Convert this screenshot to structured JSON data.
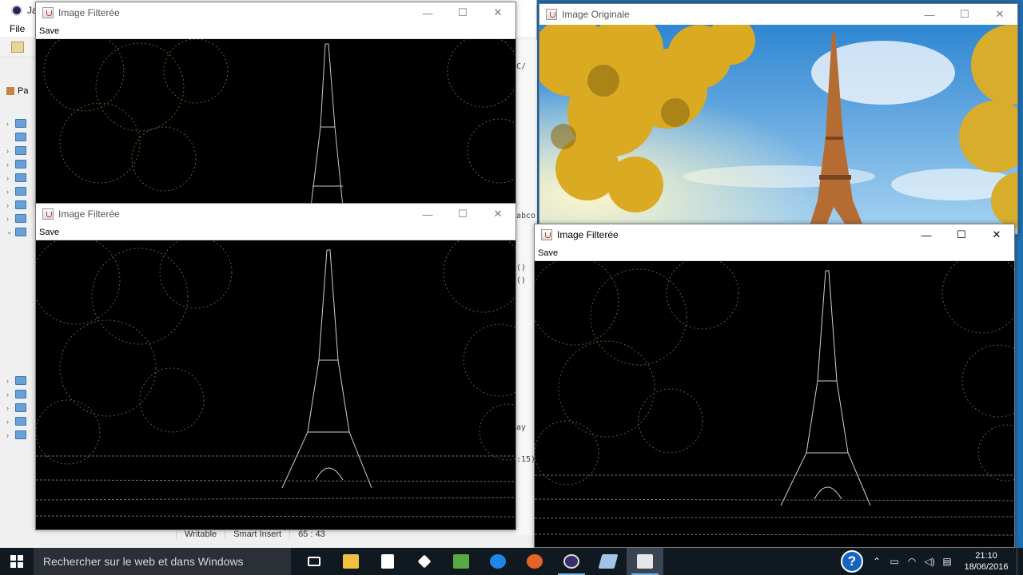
{
  "eclipse": {
    "title_fragment": "Ja",
    "menu_file": "File",
    "panel_tab_fragment": "Pa",
    "right_strip_text": [
      "C/",
      "abco",
      "()",
      "()",
      "ay",
      ":15)"
    ],
    "status": {
      "writable": "Writable",
      "insert_mode": "Smart Insert",
      "position": "65 : 43"
    }
  },
  "windows": {
    "filtered_top": {
      "title": "Image Filterée",
      "menu_save": "Save"
    },
    "filtered_mid": {
      "title": "Image Filterée",
      "menu_save": "Save"
    },
    "original": {
      "title": "Image Originale"
    },
    "filtered_right": {
      "title": "Image Filterée",
      "menu_save": "Save"
    }
  },
  "window_controls": {
    "minimize": "—",
    "maximize": "☐",
    "close": "✕"
  },
  "taskbar": {
    "search_placeholder": "Rechercher sur le web et dans Windows",
    "apps": [
      "task-view-icon",
      "file-explorer-icon",
      "store-icon",
      "dropbox-icon",
      "android-tool-icon",
      "edge-icon",
      "firefox-icon",
      "eclipse-icon",
      "notes-icon",
      "java-icon"
    ],
    "help_label": "?",
    "time": "21:10",
    "date": "18/06/2016"
  },
  "colors": {
    "edge_bg": "#000000",
    "sky_top": "#3c8fd6",
    "foliage": "#e3b52a",
    "taskbar_bg": "#101820"
  }
}
